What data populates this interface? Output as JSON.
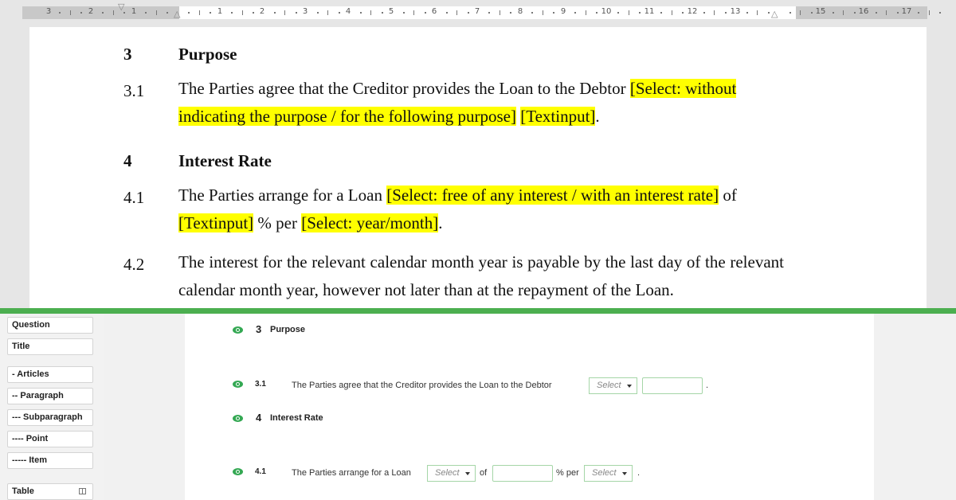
{
  "ruler": {
    "left_labels": [
      "3",
      "2",
      "1"
    ],
    "right_labels": [
      "1",
      "2",
      "3",
      "4",
      "5",
      "6",
      "7",
      "8",
      "9",
      "10",
      "11",
      "12",
      "13",
      "15",
      "16",
      "17"
    ]
  },
  "document": {
    "sections": [
      {
        "num": "3",
        "text": "Purpose"
      },
      {
        "num": "4",
        "text": "Interest Rate"
      }
    ],
    "p31": {
      "num": "3.1",
      "t1": "The Parties agree that the Creditor provides the Loan to the Debtor ",
      "h1": "[Select: without indicating the purpose / for the following purpose]",
      "t2": " ",
      "h2": "[Textinput]",
      "t3": "."
    },
    "p41": {
      "num": "4.1",
      "t1": "The Parties arrange for a Loan ",
      "h1": "[Select: free of any interest / with an interest rate]",
      "t2": " of ",
      "h2": "[Textinput]",
      "t3": " % per ",
      "h3": "[Select: year/month]",
      "t4": "."
    },
    "p42": {
      "num": "4.2",
      "text": "The interest for the relevant calendar month year is payable by the last day of the relevant calendar month year, however not later than at the repayment of the Loan."
    }
  },
  "sidebar": {
    "items": [
      "Question",
      "Title",
      "- Articles",
      "-- Paragraph",
      "--- Subparagraph",
      "---- Point",
      "----- Item",
      "Table"
    ]
  },
  "builder": {
    "s3": {
      "num": "3",
      "title": "Purpose"
    },
    "r31": {
      "num": "3.1",
      "text": "The Parties agree that the Creditor provides the Loan to the Debtor",
      "select": "Select",
      "end": "."
    },
    "s4": {
      "num": "4",
      "title": "Interest Rate"
    },
    "r41": {
      "num": "4.1",
      "text": "The Parties arrange for a Loan",
      "select1": "Select",
      "of": "of",
      "per": "% per",
      "select2": "Select",
      "end": "."
    }
  },
  "colors": {
    "highlight": "#ffff00",
    "accent_green": "#4caf50",
    "eye_green": "#34a853"
  }
}
